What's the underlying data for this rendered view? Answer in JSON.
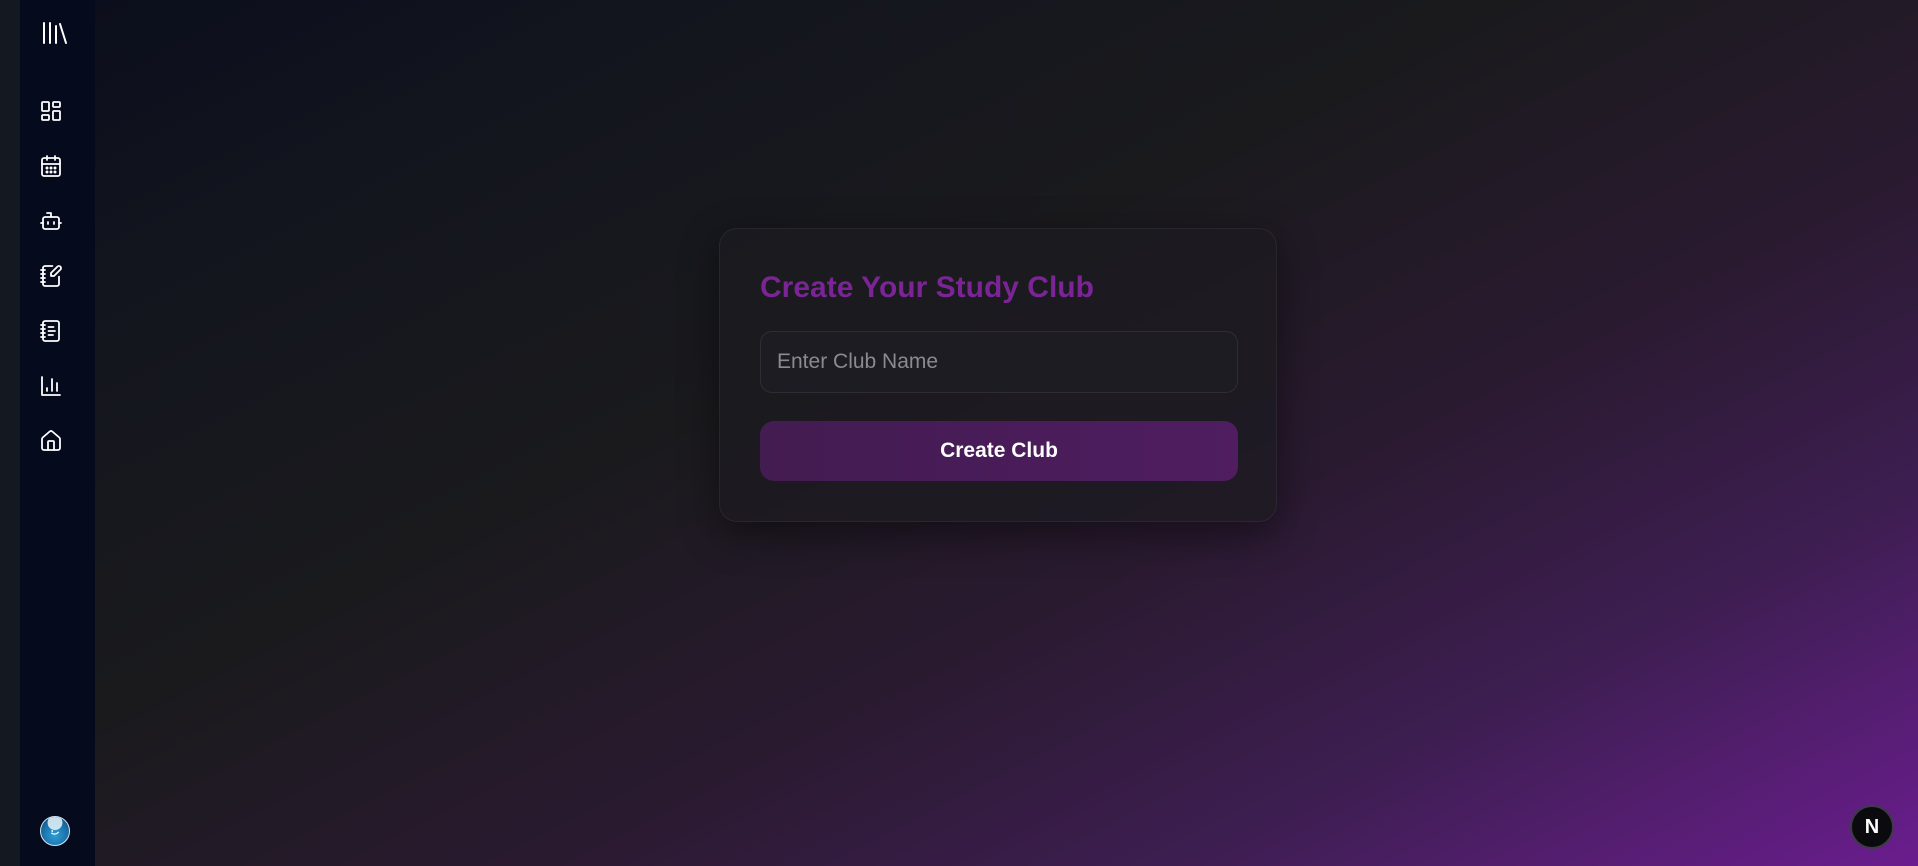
{
  "sidebar": {
    "logo_icon": "library-icon",
    "items": [
      {
        "icon": "dashboard-icon"
      },
      {
        "icon": "calendar-icon"
      },
      {
        "icon": "bot-icon"
      },
      {
        "icon": "notebook-pen-icon"
      },
      {
        "icon": "notebook-text-icon"
      },
      {
        "icon": "bar-chart-icon"
      },
      {
        "icon": "home-icon"
      }
    ],
    "avatar_icon": "user-avatar"
  },
  "card": {
    "title": "Create Your Study Club",
    "input_placeholder": "Enter Club Name",
    "input_value": "",
    "button_label": "Create Club"
  },
  "badge": {
    "label": "N",
    "icon": "nextjs-badge-icon"
  },
  "colors": {
    "title_accent": "#7a2496",
    "button_bg": "#4a1d5a",
    "sidebar_bg": "#050a1d",
    "gradient_corner": "#6a1d8e"
  }
}
